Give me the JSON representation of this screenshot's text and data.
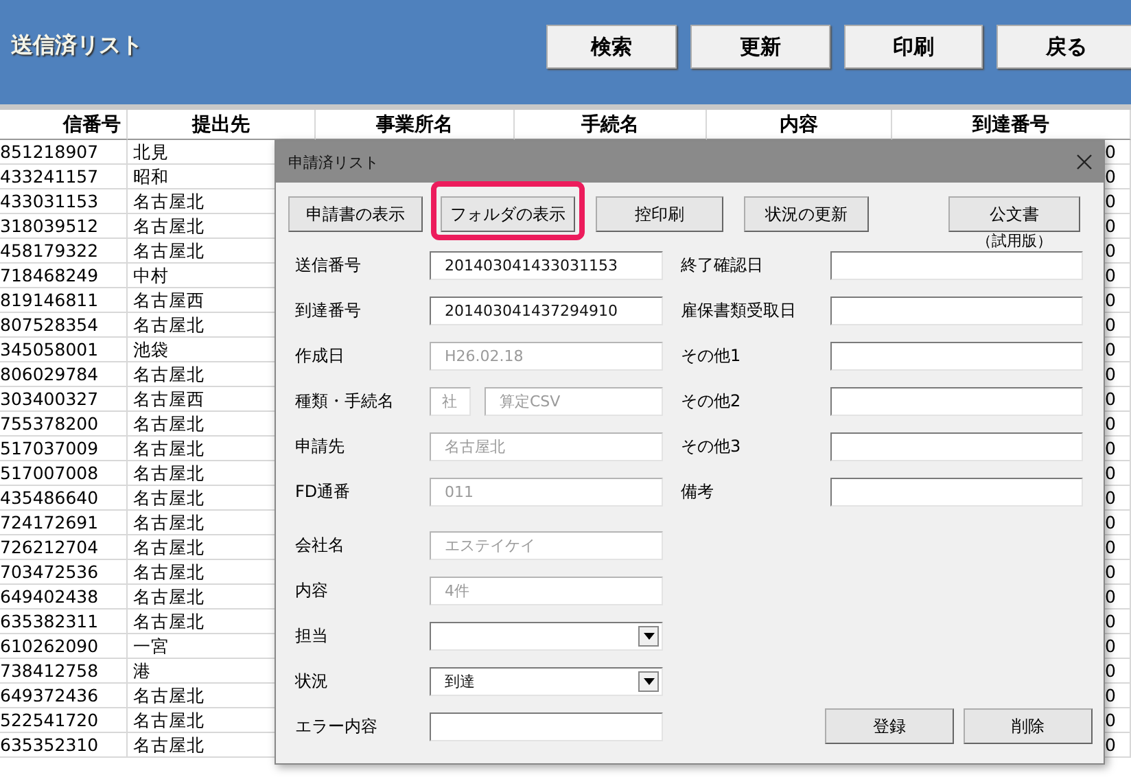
{
  "header": {
    "title": "送信済リスト",
    "buttons": [
      "検索",
      "更新",
      "印刷",
      "戻る"
    ]
  },
  "table": {
    "columns": [
      "信番号",
      "提出先",
      "事業所名",
      "手続名",
      "内容",
      "到達番号"
    ],
    "rows": [
      {
        "number": "851218907",
        "office": "北見",
        "arrival": "0"
      },
      {
        "number": "433241157",
        "office": "昭和",
        "arrival": "0"
      },
      {
        "number": "433031153",
        "office": "名古屋北",
        "arrival": "0"
      },
      {
        "number": "318039512",
        "office": "名古屋北",
        "arrival": "0"
      },
      {
        "number": "458179322",
        "office": "名古屋北",
        "arrival": "0"
      },
      {
        "number": "718468249",
        "office": "中村",
        "arrival": "0"
      },
      {
        "number": "819146811",
        "office": "名古屋西",
        "arrival": "0"
      },
      {
        "number": "807528354",
        "office": "名古屋北",
        "arrival": "0"
      },
      {
        "number": "345058001",
        "office": "池袋",
        "arrival": "0"
      },
      {
        "number": "806029784",
        "office": "名古屋北",
        "arrival": "0"
      },
      {
        "number": "303400327",
        "office": "名古屋西",
        "arrival": "0"
      },
      {
        "number": "755378200",
        "office": "名古屋北",
        "arrival": "0"
      },
      {
        "number": "517037009",
        "office": "名古屋北",
        "arrival": "0"
      },
      {
        "number": "517007008",
        "office": "名古屋北",
        "arrival": "0"
      },
      {
        "number": "435486640",
        "office": "名古屋北",
        "arrival": "0"
      },
      {
        "number": "724172691",
        "office": "名古屋北",
        "arrival": "0"
      },
      {
        "number": "726212704",
        "office": "名古屋北",
        "arrival": "0"
      },
      {
        "number": "703472536",
        "office": "名古屋北",
        "arrival": "0"
      },
      {
        "number": "649402438",
        "office": "名古屋北",
        "arrival": "0"
      },
      {
        "number": "635382311",
        "office": "名古屋北",
        "arrival": "0"
      },
      {
        "number": "610262090",
        "office": "一宮",
        "arrival": "0"
      },
      {
        "number": "738412758",
        "office": "港",
        "arrival": "0"
      },
      {
        "number": "649372436",
        "office": "名古屋北",
        "arrival": "0"
      },
      {
        "number": "522541720",
        "office": "名古屋北",
        "arrival": "0"
      },
      {
        "number": "635352310",
        "office": "名古屋北",
        "arrival": "0"
      }
    ]
  },
  "dialog": {
    "title": "申請済リスト",
    "buttons": [
      {
        "label": "申請書の表示",
        "highlighted": false
      },
      {
        "label": "フォルダの表示",
        "highlighted": true
      },
      {
        "label": "控印刷",
        "highlighted": false
      },
      {
        "label": "状況の更新",
        "highlighted": false
      },
      {
        "label": "公文書",
        "note": "（試用版）",
        "highlighted": false
      }
    ],
    "left_fields": [
      {
        "label": "送信番号",
        "kind": "text",
        "value": "201403041433031153",
        "disabled": false
      },
      {
        "label": "到達番号",
        "kind": "text",
        "value": "201403041437294910",
        "disabled": false
      },
      {
        "label": "作成日",
        "kind": "text",
        "value": "H26.02.18",
        "disabled": true
      },
      {
        "label": "種類・手続名",
        "kind": "pair",
        "values": [
          "社",
          "算定CSV"
        ],
        "disabled": true
      },
      {
        "label": "申請先",
        "kind": "text",
        "value": "名古屋北",
        "disabled": true
      },
      {
        "label": "FD通番",
        "kind": "text",
        "value": "011",
        "disabled": true
      },
      {
        "label": "会社名",
        "kind": "text",
        "value": "エステイケイ",
        "disabled": true
      },
      {
        "label": "内容",
        "kind": "text",
        "value": "4件",
        "disabled": true
      },
      {
        "label": "担当",
        "kind": "select",
        "disabled": false
      },
      {
        "label": "状況",
        "kind": "select",
        "value": "到達",
        "disabled": false
      },
      {
        "label": "エラー内容",
        "kind": "text",
        "disabled": false
      }
    ],
    "right_fields": [
      {
        "label": "終了確認日",
        "kind": "text",
        "disabled": false
      },
      {
        "label": "雇保書類受取日",
        "kind": "text",
        "disabled": false
      },
      {
        "label": "その他1",
        "kind": "text",
        "disabled": false
      },
      {
        "label": "その他2",
        "kind": "text",
        "disabled": false
      },
      {
        "label": "その他3",
        "kind": "text",
        "disabled": false
      },
      {
        "label": "備考",
        "kind": "text",
        "disabled": false
      }
    ],
    "actions": [
      "登録",
      "削除"
    ]
  }
}
